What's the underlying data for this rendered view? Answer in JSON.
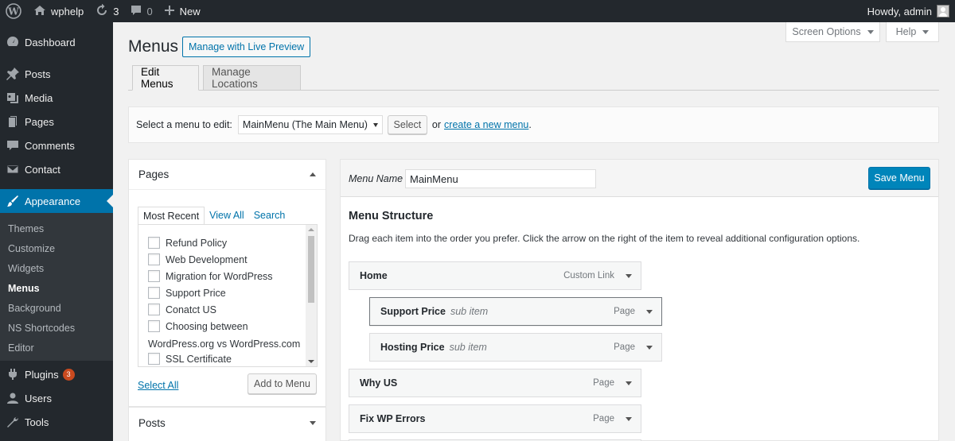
{
  "admin_bar": {
    "site_name": "wphelp",
    "updates_count": "3",
    "comments_count": "0",
    "new_label": "New",
    "howdy": "Howdy, admin"
  },
  "sidebar": {
    "items": [
      {
        "label": "Dashboard",
        "icon": "dashboard-icon"
      },
      {
        "label": "Posts",
        "icon": "pin-icon"
      },
      {
        "label": "Media",
        "icon": "media-icon"
      },
      {
        "label": "Pages",
        "icon": "pages-icon"
      },
      {
        "label": "Comments",
        "icon": "comment-icon"
      },
      {
        "label": "Contact",
        "icon": "mail-icon"
      },
      {
        "label": "Appearance",
        "icon": "brush-icon"
      },
      {
        "label": "Plugins",
        "icon": "plug-icon",
        "badge": "3"
      },
      {
        "label": "Users",
        "icon": "user-icon"
      },
      {
        "label": "Tools",
        "icon": "wrench-icon"
      }
    ],
    "submenu": [
      "Themes",
      "Customize",
      "Widgets",
      "Menus",
      "Background",
      "NS Shortcodes",
      "Editor"
    ]
  },
  "header": {
    "screen_options": "Screen Options",
    "help": "Help",
    "title": "Menus",
    "live_preview": "Manage with Live Preview",
    "tabs": [
      {
        "label": "Edit Menus"
      },
      {
        "label": "Manage Locations"
      }
    ]
  },
  "select_bar": {
    "label": "Select a menu to edit:",
    "selected": "MainMenu (The Main Menu)",
    "select_button": "Select",
    "or": "or",
    "create_link": "create a new menu",
    "period": "."
  },
  "pages_box": {
    "title": "Pages",
    "tabs": [
      "Most Recent",
      "View All",
      "Search"
    ],
    "items": [
      "Refund Policy",
      "Web Development",
      "Migration for WordPress",
      "Support Price",
      "Conatct US",
      "Choosing between"
    ],
    "wrapped_line": "WordPress.org vs WordPress.com",
    "last_item": "SSL Certificate",
    "select_all": "Select All",
    "add_button": "Add to Menu"
  },
  "posts_box": {
    "title": "Posts"
  },
  "menu_editor": {
    "name_label": "Menu Name",
    "name_value": "MainMenu",
    "save_button": "Save Menu",
    "structure_title": "Menu Structure",
    "structure_desc": "Drag each item into the order you prefer. Click the arrow on the right of the item to reveal additional configuration options.",
    "items": [
      {
        "title": "Home",
        "sub": "",
        "type": "Custom Link"
      },
      {
        "title": "Support Price",
        "sub": "sub item",
        "type": "Page"
      },
      {
        "title": "Hosting Price",
        "sub": "sub item",
        "type": "Page"
      },
      {
        "title": "Why US",
        "sub": "",
        "type": "Page"
      },
      {
        "title": "Fix WP Errors",
        "sub": "",
        "type": "Page"
      }
    ]
  },
  "colors": {
    "admin_dark": "#23282d",
    "accent_blue": "#0073aa",
    "primary_button": "#0085ba",
    "badge_orange": "#ca4a1f"
  }
}
